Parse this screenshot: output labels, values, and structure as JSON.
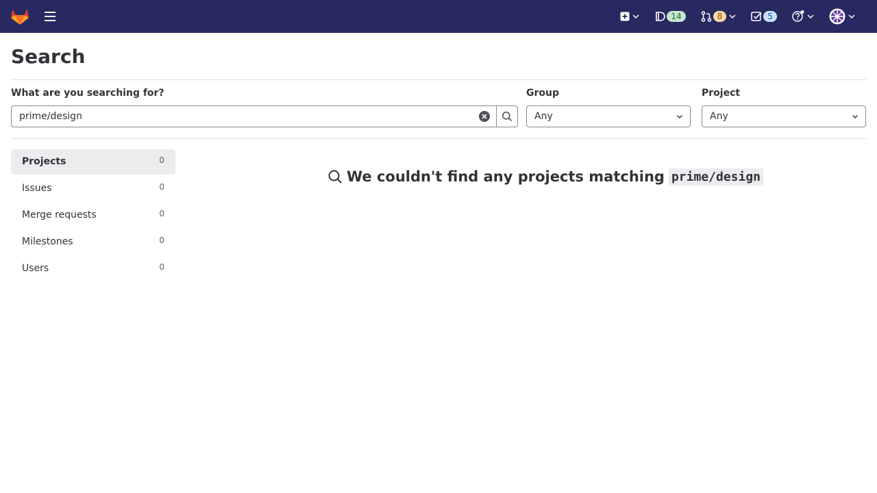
{
  "topbar": {
    "logo_icon": "gitlab-tanuki-icon",
    "menu_icon": "hamburger-icon",
    "items": [
      {
        "name": "create-new",
        "icon": "plus-square-icon",
        "badge": null
      },
      {
        "name": "issues",
        "icon": "issues-icon",
        "badge": "14"
      },
      {
        "name": "merge-requests",
        "icon": "merge-request-icon",
        "badge": "8"
      },
      {
        "name": "todos",
        "icon": "todo-check-icon",
        "badge": "5"
      },
      {
        "name": "help",
        "icon": "question-circle-icon",
        "badge": null
      },
      {
        "name": "user-menu",
        "icon": "avatar-icon",
        "badge": null
      }
    ],
    "colors": {
      "bar": "#292961"
    }
  },
  "page": {
    "title": "Search"
  },
  "search": {
    "label": "What are you searching for?",
    "value": "prime/design"
  },
  "group_filter": {
    "label": "Group",
    "value": "Any"
  },
  "project_filter": {
    "label": "Project",
    "value": "Any"
  },
  "sidebar": {
    "items": [
      {
        "label": "Projects",
        "count": "0",
        "active": true
      },
      {
        "label": "Issues",
        "count": "0",
        "active": false
      },
      {
        "label": "Merge requests",
        "count": "0",
        "active": false
      },
      {
        "label": "Milestones",
        "count": "0",
        "active": false
      },
      {
        "label": "Users",
        "count": "0",
        "active": false
      }
    ]
  },
  "results": {
    "empty_message": "We couldn't find any projects matching",
    "query": "prime/design"
  }
}
